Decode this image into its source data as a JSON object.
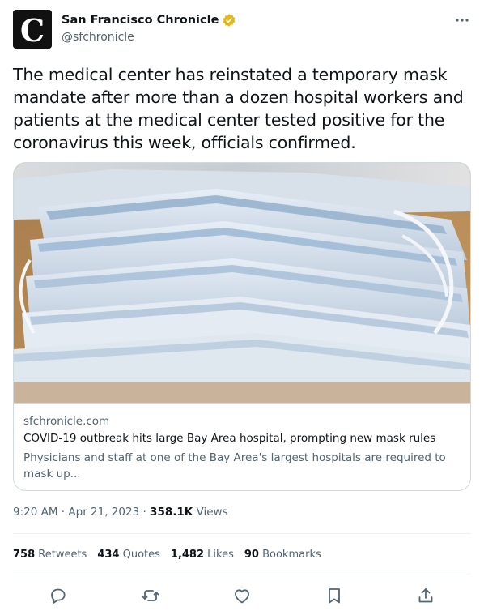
{
  "account": {
    "name": "San Francisco Chronicle",
    "handle": "@sfchronicle",
    "avatar_letter": "C",
    "verified_color": "#e2b719"
  },
  "tweet": {
    "text": "The medical center has reinstated a temporary mask mandate after more than a dozen hospital workers and patients at the medical center tested positive for the coronavirus this week, officials confirmed."
  },
  "card": {
    "image_subject": "box of disposable face masks",
    "domain": "sfchronicle.com",
    "title": "COVID-19 outbreak hits large Bay Area hospital, prompting new mask rules",
    "description": "Physicians and staff at one of the Bay Area's largest hospitals are required to mask up..."
  },
  "meta": {
    "time": "9:20 AM",
    "separator": "·",
    "date": "Apr 21, 2023",
    "views_count": "358.1K",
    "views_label": "Views"
  },
  "stats": {
    "retweets_count": "758",
    "retweets_label": "Retweets",
    "quotes_count": "434",
    "quotes_label": "Quotes",
    "likes_count": "1,482",
    "likes_label": "Likes",
    "bookmarks_count": "90",
    "bookmarks_label": "Bookmarks"
  },
  "actions": {
    "icons": [
      "reply-icon",
      "retweet-icon",
      "like-icon",
      "bookmark-icon",
      "share-icon"
    ],
    "icon_color": "#536471"
  }
}
